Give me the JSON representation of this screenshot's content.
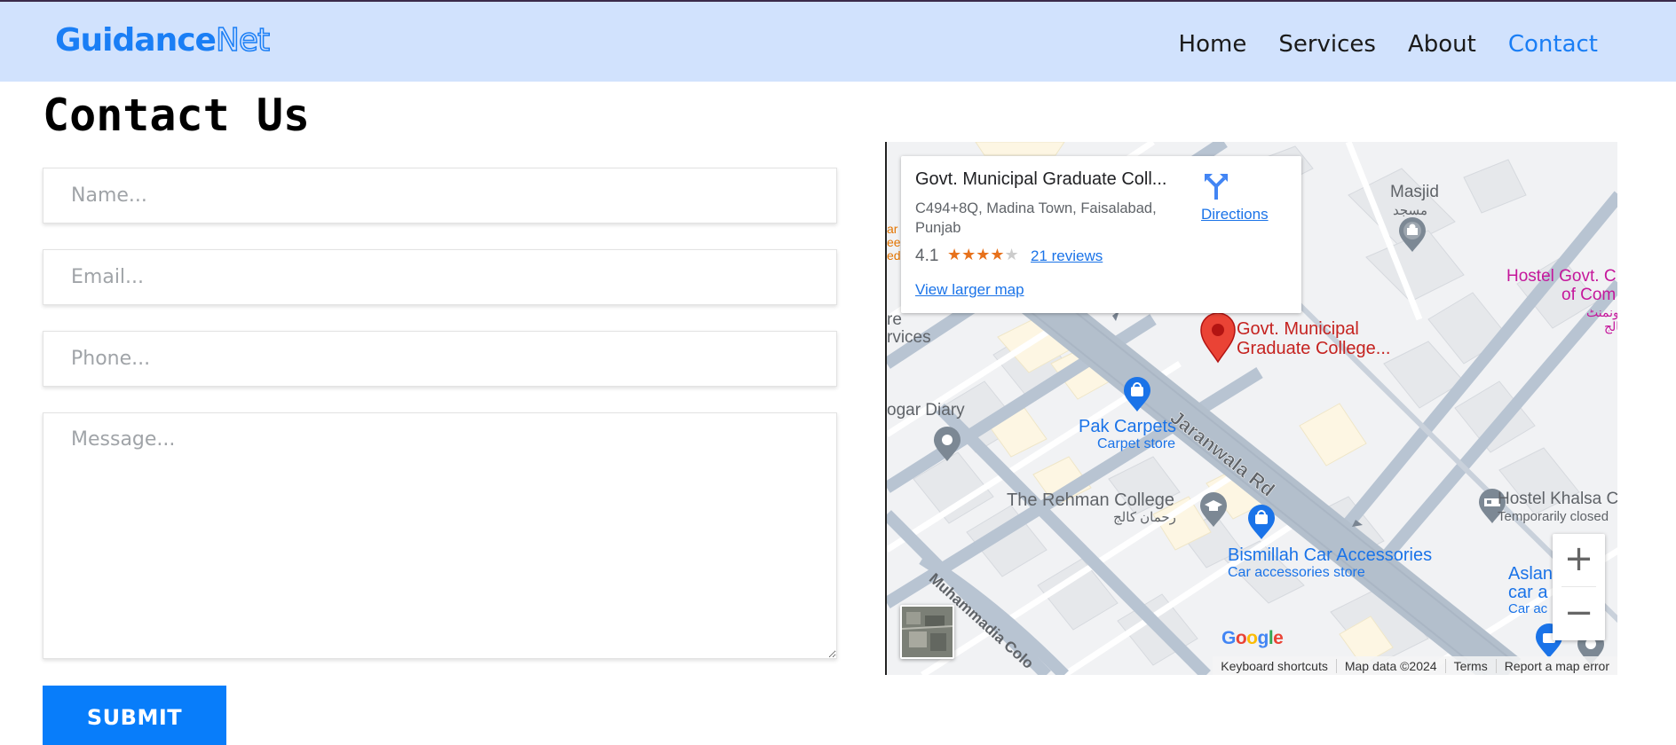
{
  "header": {
    "logo_part1": "Guidance",
    "logo_part2": "Net",
    "nav": [
      {
        "label": "Home"
      },
      {
        "label": "Services"
      },
      {
        "label": "About"
      },
      {
        "label": "Contact",
        "active": true
      }
    ]
  },
  "main": {
    "title": "Contact Us",
    "form": {
      "name_placeholder": "Name...",
      "email_placeholder": "Email...",
      "phone_placeholder": "Phone...",
      "message_placeholder": "Message...",
      "submit_label": "SUBMIT"
    }
  },
  "map": {
    "card": {
      "title": "Govt. Municipal Graduate Coll...",
      "address": "C494+8Q, Madina Town, Faisalabad, Punjab",
      "rating": "4.1",
      "stars": "★★★★",
      "stars_off": "★",
      "reviews": "21 reviews",
      "larger_map": "View larger map",
      "directions": "Directions"
    },
    "labels": {
      "masjid": "Masjid",
      "masjid_urdu": "مسجد",
      "hostel_govt_1": "Hostel Govt. C",
      "hostel_govt_2": "of Com",
      "hostel_govt_urdu": "یونمنٹ",
      "hostel_govt_urdu2": "کالج",
      "pin_1": "Govt. Municipal",
      "pin_2": "Graduate College...",
      "services_1": "re",
      "services_2": "rvices",
      "bogar": "ogar Diary",
      "pak_carpets": "Pak Carpets",
      "carpet_store": "Carpet store",
      "jaranwala": "Jaranwala Rd",
      "rehman": "The Rehman College",
      "rehman_urdu": "رحمان کالج",
      "bismillah": "Bismillah Car Accessories",
      "car_acc_store": "Car accessories store",
      "hostel_khalsa": "Hostel Khalsa C",
      "temporarily_closed": "Temporarily closed",
      "aslam_1": "Aslan",
      "aslam_2": "car a",
      "aslam_3": "Car ac",
      "muhammadia": "Muhammadia Colo",
      "left_edge_1": "ar",
      "left_edge_2": "ee",
      "left_edge_3": "ed"
    },
    "zoom_in": "+",
    "zoom_out": "−",
    "google": [
      "G",
      "o",
      "o",
      "g",
      "l",
      "e"
    ],
    "attribution": [
      "Keyboard shortcuts",
      "Map data ©2024",
      "Terms",
      "Report a map error"
    ]
  }
}
